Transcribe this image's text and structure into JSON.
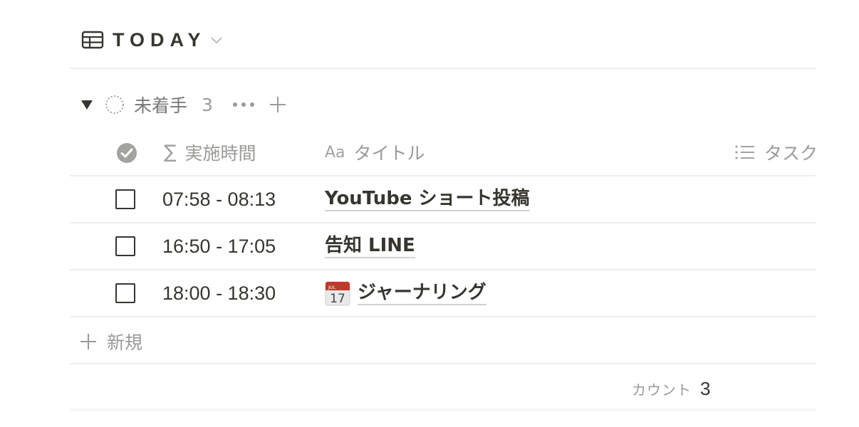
{
  "view": {
    "title": "TODAY",
    "icon": "table-icon"
  },
  "group": {
    "label": "未着手",
    "count": "3"
  },
  "columns": {
    "time": "実施時間",
    "time_icon": "∑",
    "title": "タイトル",
    "title_icon": "Aa",
    "tags": "タスク"
  },
  "rows": [
    {
      "checked": false,
      "time": "07:58 - 08:13",
      "title": "YouTube ショート投稿",
      "icon": ""
    },
    {
      "checked": false,
      "time": "16:50 - 17:05",
      "title": "告知 LINE",
      "icon": ""
    },
    {
      "checked": false,
      "time": "18:00 - 18:30",
      "title": "ジャーナリング",
      "icon": "calendar-icon",
      "icon_month": "JUL",
      "icon_day": "17"
    }
  ],
  "new_label": "新規",
  "footer": {
    "count_label": "カウント",
    "count_value": "3"
  },
  "colors": {
    "text": "#37352f",
    "muted": "#9b9a97",
    "divider": "#ededec",
    "calendar_red": "#c0392b"
  }
}
